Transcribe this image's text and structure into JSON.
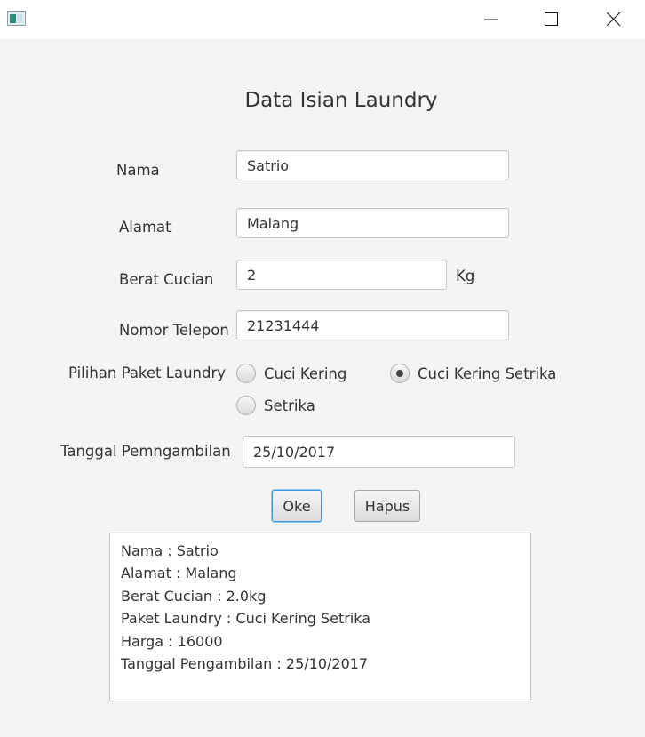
{
  "window": {
    "minimize_icon": "minimize-icon",
    "maximize_icon": "maximize-icon",
    "close_icon": "close-icon"
  },
  "form": {
    "title": "Data Isian Laundry",
    "nama": {
      "label": "Nama",
      "value": "Satrio"
    },
    "alamat": {
      "label": "Alamat",
      "value": "Malang"
    },
    "berat": {
      "label": "Berat Cucian",
      "value": "2",
      "unit": "Kg"
    },
    "telepon": {
      "label": "Nomor Telepon",
      "value": "21231444"
    },
    "paket": {
      "label": "Pilihan Paket Laundry",
      "options": [
        {
          "label": "Cuci Kering",
          "selected": false
        },
        {
          "label": "Cuci Kering Setrika",
          "selected": true
        },
        {
          "label": "Setrika",
          "selected": false
        }
      ]
    },
    "tanggal": {
      "label": "Tanggal Pemngambilan",
      "value": "25/10/2017"
    }
  },
  "buttons": {
    "ok": "Oke",
    "hapus": "Hapus"
  },
  "output": {
    "lines": [
      "Nama : Satrio",
      "Alamat : Malang",
      "Berat Cucian : 2.0kg",
      "Paket Laundry : Cuci Kering Setrika",
      "Harga : 16000",
      "Tanggal Pengambilan : 25/10/2017"
    ]
  },
  "colors": {
    "focus": "#3a9bd9",
    "background": "#f4f4f4"
  }
}
